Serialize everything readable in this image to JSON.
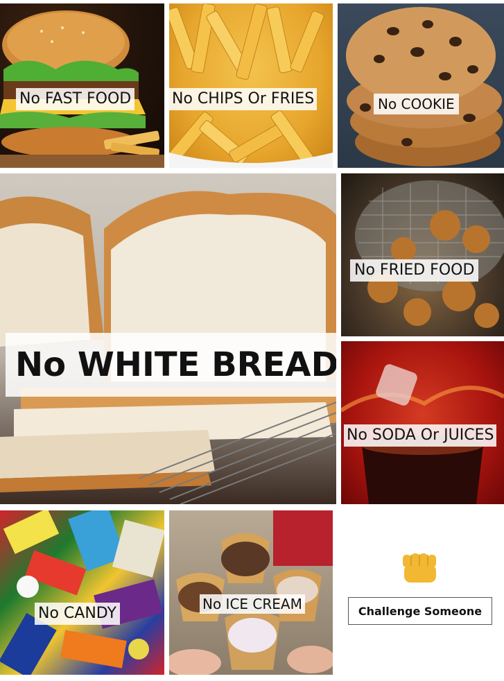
{
  "tiles": {
    "burger": {
      "label": "No FAST FOOD"
    },
    "fries": {
      "label": "No CHIPS Or FRIES"
    },
    "cookie": {
      "label": "No COOKIE"
    },
    "bread": {
      "label": "No WHITE BREAD"
    },
    "fried": {
      "label": "No FRIED FOOD"
    },
    "soda": {
      "label": "No SODA Or JUICES"
    },
    "candy": {
      "label": "No CANDY"
    },
    "ice_cream": {
      "label": "No ICE CREAM"
    }
  },
  "challenge": {
    "button_label": "Challenge Someone",
    "icon": "fist-icon"
  },
  "colors": {
    "label_bg": "#ffffff",
    "label_text": "#111111",
    "fist": "#f2b833"
  }
}
